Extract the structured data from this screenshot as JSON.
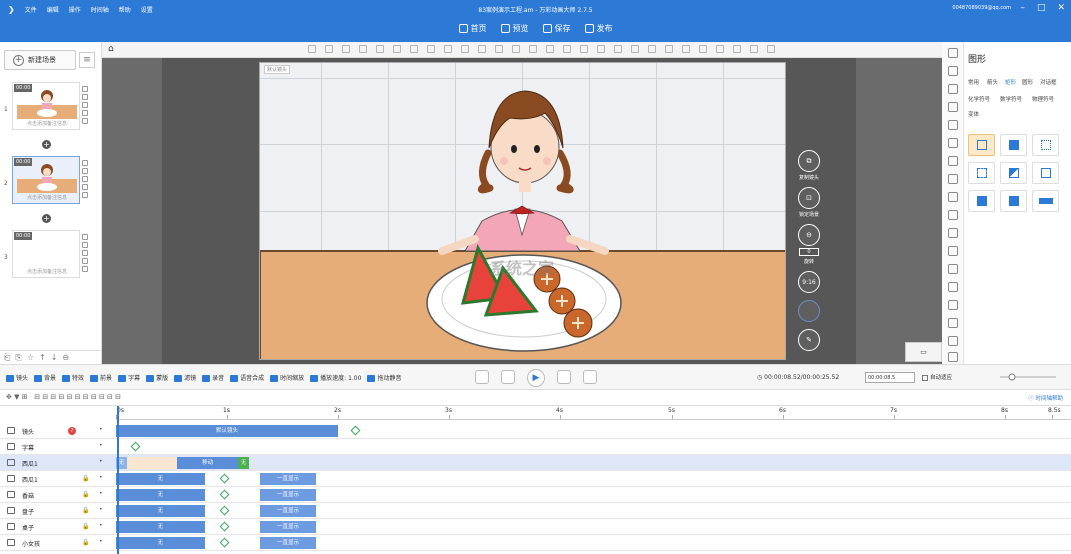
{
  "titlebar": {
    "menu": [
      "文件",
      "编辑",
      "操作",
      "时间轴",
      "帮助",
      "设置"
    ],
    "title": "83案例演示工程.am - 万彩动画大师 2.7.5",
    "account": "00487089039@qq.com",
    "toolbar": [
      {
        "icon": "home-icon",
        "label": "首页"
      },
      {
        "icon": "preview-icon",
        "label": "预览"
      },
      {
        "icon": "save-icon",
        "label": "保存"
      },
      {
        "icon": "publish-icon",
        "label": "发布"
      }
    ]
  },
  "left_panel": {
    "new_scene_label": "新建场景",
    "scenes": [
      {
        "number": "1",
        "time": "00:00",
        "caption": "点击添加备注信息",
        "has_thumb": true,
        "selected": false
      },
      {
        "number": "2",
        "time": "00:00",
        "caption": "点击添加备注信息",
        "has_thumb": true,
        "selected": true
      },
      {
        "number": "3",
        "time": "00:00",
        "caption": "点击添加备注信息",
        "has_thumb": false,
        "selected": false
      }
    ]
  },
  "canvas": {
    "camera_label": "默认镜头",
    "controls": [
      {
        "icon": "copy-camera-icon",
        "label": "复制镜头"
      },
      {
        "icon": "lock-scene-icon",
        "label": "锁定场景"
      },
      {
        "icon": "rotate-icon",
        "label": "旋转",
        "value": "0"
      },
      {
        "icon": "ratio-icon",
        "label": "9:16"
      },
      {
        "icon": "aspect-icon",
        "label": ""
      },
      {
        "icon": "edit-icon",
        "label": ""
      }
    ]
  },
  "right_panel": {
    "title": "图形",
    "tabs": [
      "常用",
      "箭头",
      "矩形",
      "圆形",
      "对话框",
      "化学符号",
      "数学符号",
      "物理符号",
      "变体"
    ],
    "active_tab": "矩形"
  },
  "timeline_bar": {
    "items": [
      "镜头",
      "背景",
      "特效",
      "前景",
      "字幕",
      "蒙版",
      "滤镜",
      "录音",
      "语音合成",
      "时间缩放"
    ],
    "speed_label": "播放速度: 1.00",
    "mute_label": "拖动静音",
    "time_readout": "00:00:08.52/00:00:25.52",
    "zoom_value": "00:00:08.5",
    "auto_adapt_label": "自动适应",
    "help_label": "时间轴帮助"
  },
  "timeline": {
    "ruler": [
      "0s",
      "1s",
      "2s",
      "3s",
      "4s",
      "5s",
      "6s",
      "7s",
      "8s",
      "8.5s"
    ],
    "tracks": [
      {
        "name": "镜头",
        "segments": [
          {
            "label": "默认镜头",
            "start": 0,
            "end": 2.0
          }
        ],
        "keys": [
          2.15
        ]
      },
      {
        "name": "字幕",
        "segments": [],
        "keys": [
          0.17
        ]
      },
      {
        "name": "西瓜1",
        "segments": [
          {
            "label": "无",
            "start": 0,
            "end": 0.1
          },
          {
            "label": "移动",
            "start": 0.55,
            "end": 1.1
          },
          {
            "label": "无",
            "start": 1.1,
            "end": 1.2
          }
        ],
        "keys": [],
        "highlight": true
      },
      {
        "name": "西瓜1",
        "segments": [
          {
            "label": "无",
            "start": 0,
            "end": 0.8
          },
          {
            "label": "一直显示",
            "start": 1.3,
            "end": 1.8
          }
        ],
        "keys": [
          0.97
        ]
      },
      {
        "name": "香菇",
        "segments": [
          {
            "label": "无",
            "start": 0,
            "end": 0.8
          },
          {
            "label": "一直显示",
            "start": 1.3,
            "end": 1.8
          }
        ],
        "keys": [
          0.97
        ]
      },
      {
        "name": "盘子",
        "segments": [
          {
            "label": "无",
            "start": 0,
            "end": 0.8
          },
          {
            "label": "一直显示",
            "start": 1.3,
            "end": 1.8
          }
        ],
        "keys": [
          0.97
        ]
      },
      {
        "name": "桌子",
        "segments": [
          {
            "label": "无",
            "start": 0,
            "end": 0.8
          },
          {
            "label": "一直显示",
            "start": 1.3,
            "end": 1.8
          }
        ],
        "keys": [
          0.97
        ]
      },
      {
        "name": "小女孩",
        "segments": [
          {
            "label": "无",
            "start": 0,
            "end": 0.8
          },
          {
            "label": "一直显示",
            "start": 1.3,
            "end": 1.8
          }
        ],
        "keys": [
          0.97
        ]
      }
    ]
  },
  "watermark": "系统之家"
}
